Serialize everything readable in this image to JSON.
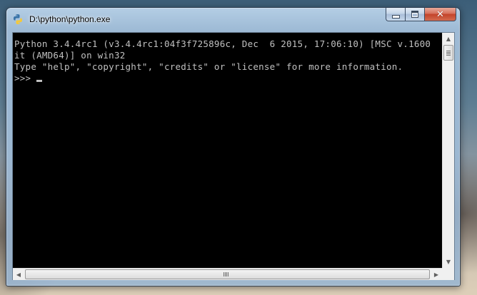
{
  "window": {
    "title": "D:\\python\\python.exe",
    "icon": "python-icon",
    "caption_buttons": {
      "minimize": "minimize-icon",
      "maximize": "maximize-icon",
      "close": "close-icon"
    }
  },
  "console": {
    "lines": [
      "Python 3.4.4rc1 (v3.4.4rc1:04f3f725896c, Dec  6 2015, 17:06:10) [MSC v.1600",
      "it (AMD64)] on win32",
      "Type \"help\", \"copyright\", \"credits\" or \"license\" for more information."
    ],
    "prompt": ">>> ",
    "text_color": "#c0c0c0",
    "background_color": "#000000"
  },
  "scrollbars": {
    "vertical": {
      "up_icon": "arrow-up-icon",
      "down_icon": "arrow-down-icon",
      "thumb_position": 0
    },
    "horizontal": {
      "left_icon": "arrow-left-icon",
      "right_icon": "arrow-right-icon",
      "thumb_position": 0
    }
  }
}
